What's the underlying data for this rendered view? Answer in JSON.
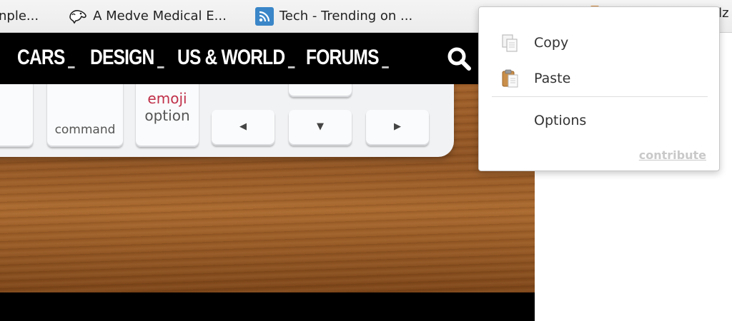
{
  "bookmarks": {
    "items": [
      {
        "label": "nple...",
        "icon": "truncated-bookmark"
      },
      {
        "label": "A Medve Medical E...",
        "icon": "dog-icon"
      },
      {
        "label": "Tech - Trending on ...",
        "icon": "rss-icon"
      }
    ],
    "right_fragment": "elz"
  },
  "nav": {
    "items": [
      {
        "label": "CARS"
      },
      {
        "label": "DESIGN"
      },
      {
        "label": "US & WORLD"
      },
      {
        "label": "FORUMS"
      }
    ],
    "search_icon": "search-icon"
  },
  "keyboard": {
    "command_label": "command",
    "command_symbol": "⌘",
    "emoji_label": "emoji",
    "option_label": "option",
    "arrow_left": "◀",
    "arrow_down": "▼",
    "arrow_right": "▶"
  },
  "context_menu": {
    "copy_label": "Copy",
    "paste_label": "Paste",
    "options_label": "Options",
    "contribute_label": "contribute"
  },
  "colors": {
    "nav_background": "#000000",
    "emoji_key": "#c0304a",
    "rss_icon": "#3a86c8",
    "contribute_link": "#c9c9c9"
  }
}
